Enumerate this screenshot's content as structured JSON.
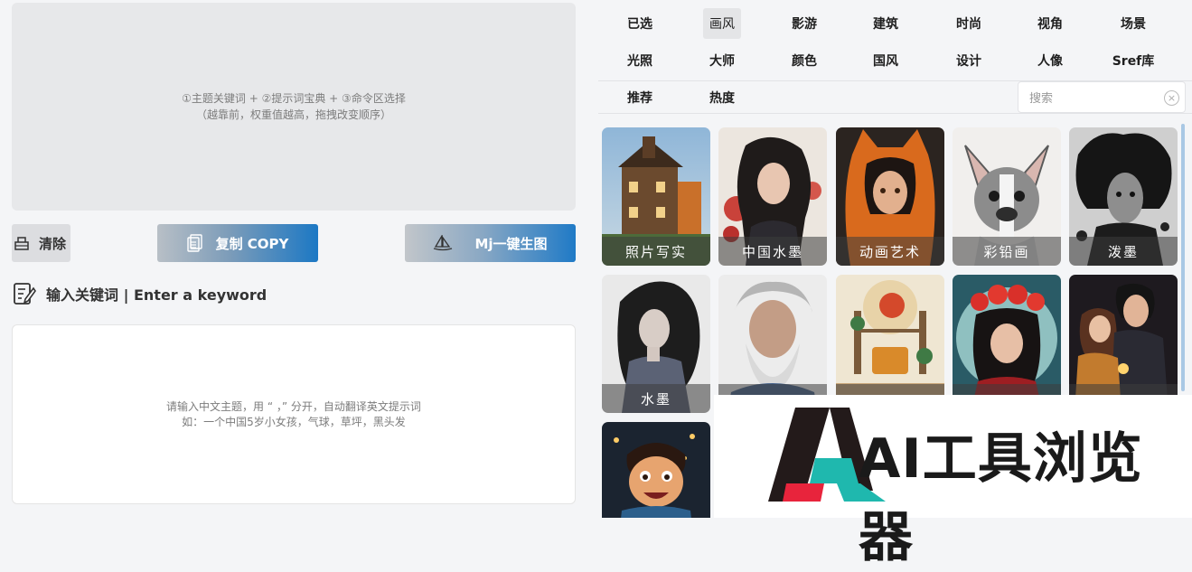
{
  "prompt_area": {
    "line1": "①主题关键词 + ②提示词宝典 + ③命令区选择",
    "line2": "（越靠前，权重值越高，拖拽改变顺序）"
  },
  "buttons": {
    "clear": "清除",
    "copy": "复制 COPY",
    "mj": "Mj一键生图"
  },
  "keyword": {
    "title": "输入关键词 | Enter a keyword",
    "placeholder_line1": "请输入中文主题，用 “ ，” 分开，自动翻译英文提示词",
    "placeholder_line2": "如：一个中国5岁小女孩，气球，草坪，黑头发"
  },
  "tabs": [
    "已选",
    "画风",
    "影游",
    "建筑",
    "时尚",
    "视角",
    "场景",
    "光照",
    "大师",
    "颜色",
    "国风",
    "设计",
    "人像",
    "Sref库",
    "推荐",
    "热度"
  ],
  "active_tab": "画风",
  "search": {
    "placeholder": "搜索"
  },
  "cards": [
    {
      "label": "照片写实"
    },
    {
      "label": "中国水墨"
    },
    {
      "label": "动画艺术"
    },
    {
      "label": "彩铅画"
    },
    {
      "label": "泼墨"
    },
    {
      "label": "水墨"
    },
    {
      "label": ""
    },
    {
      "label": ""
    },
    {
      "label": ""
    },
    {
      "label": ""
    },
    {
      "label": ""
    }
  ],
  "watermark": {
    "text": "AI工具浏览器"
  },
  "colors": {
    "accent": "#1c78c4",
    "watermark_teal": "#1fb8ae",
    "watermark_red": "#e8243c"
  }
}
